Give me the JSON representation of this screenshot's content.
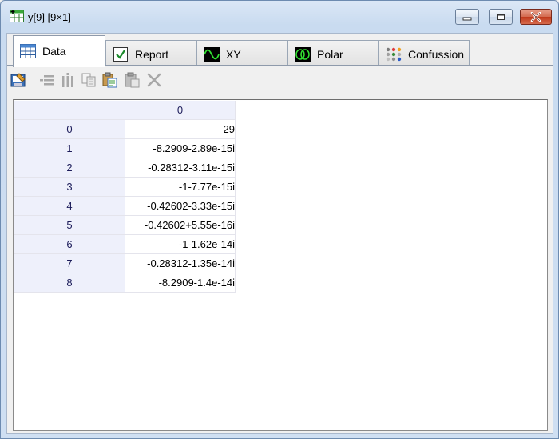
{
  "window": {
    "title": "y[9] [9×1]",
    "accent": "#c9dbf0"
  },
  "tabs": [
    {
      "label": "Data",
      "icon": "table-icon",
      "active": true
    },
    {
      "label": "Report",
      "icon": "checkbox-icon",
      "active": false
    },
    {
      "label": "XY",
      "icon": "sine-wave-icon",
      "active": false
    },
    {
      "label": "Polar",
      "icon": "polar-plot-icon",
      "active": false
    },
    {
      "label": "Confussion",
      "icon": "confusion-matrix-icon",
      "active": false
    }
  ],
  "toolbar": [
    {
      "name": "edit-icon",
      "enabled": true
    },
    {
      "name": "insert-rows-icon",
      "enabled": false
    },
    {
      "name": "insert-columns-icon",
      "enabled": false
    },
    {
      "name": "copy-icon",
      "enabled": false
    },
    {
      "name": "paste-special-icon",
      "enabled": true
    },
    {
      "name": "paste-icon",
      "enabled": false
    },
    {
      "name": "delete-icon",
      "enabled": false
    }
  ],
  "grid": {
    "columns": [
      "0"
    ],
    "rows": [
      {
        "index": "0",
        "value": "29"
      },
      {
        "index": "1",
        "value": "-8.2909-2.89e-15i"
      },
      {
        "index": "2",
        "value": "-0.28312-3.11e-15i"
      },
      {
        "index": "3",
        "value": "-1-7.77e-15i"
      },
      {
        "index": "4",
        "value": "-0.42602-3.33e-15i"
      },
      {
        "index": "5",
        "value": "-0.42602+5.55e-16i"
      },
      {
        "index": "6",
        "value": "-1-1.62e-14i"
      },
      {
        "index": "7",
        "value": "-0.28312-1.35e-14i"
      },
      {
        "index": "8",
        "value": "-8.2909-1.4e-14i"
      }
    ]
  }
}
